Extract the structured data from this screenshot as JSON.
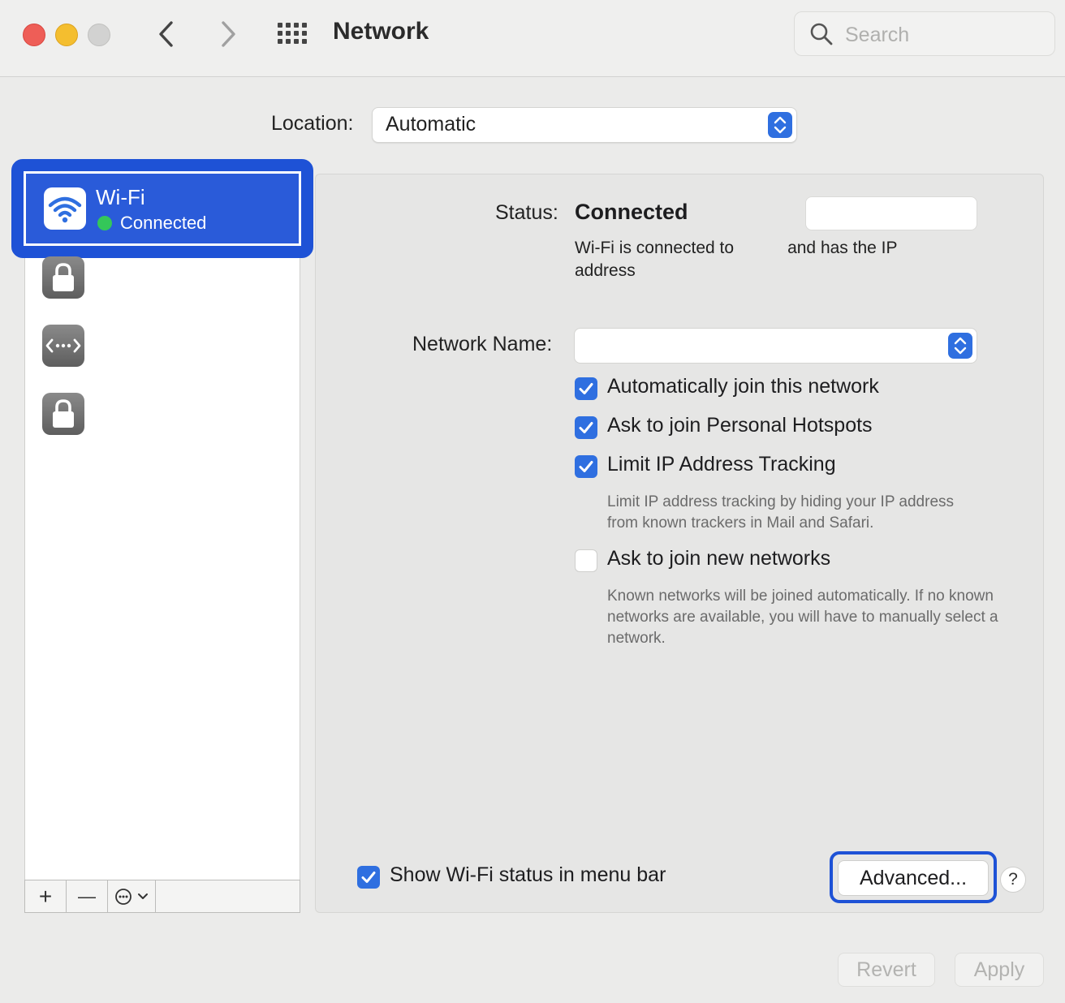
{
  "window": {
    "title": "Network",
    "search_placeholder": "Search"
  },
  "location": {
    "label": "Location:",
    "value": "Automatic"
  },
  "sidebar": {
    "selected_service": {
      "name": "Wi-Fi",
      "status": "Connected",
      "icon": "wifi-icon",
      "status_color": "#34c759"
    },
    "other_services": [
      {
        "icon": "lock-icon"
      },
      {
        "icon": "vpn-arrows-icon"
      },
      {
        "icon": "lock-icon"
      }
    ],
    "toolbar": {
      "add": "+",
      "remove": "—",
      "action_icon": "ellipsis-circle-icon"
    }
  },
  "detail": {
    "status_label": "Status:",
    "status_value": "Connected",
    "status_desc_part1": "Wi-Fi is connected to",
    "status_desc_part2": "and has the IP address",
    "network_name_label": "Network Name:",
    "checkboxes": [
      {
        "label": "Automatically join this network",
        "checked": true
      },
      {
        "label": "Ask to join Personal Hotspots",
        "checked": true
      },
      {
        "label": "Limit IP Address Tracking",
        "checked": true,
        "help": "Limit IP address tracking by hiding your IP address from known trackers in Mail and Safari."
      },
      {
        "label": "Ask to join new networks",
        "checked": false,
        "help": "Known networks will be joined automatically. If no known networks are available, you will have to manually select a network."
      }
    ],
    "show_status": {
      "label": "Show Wi-Fi status in menu bar",
      "checked": true
    },
    "advanced_button": "Advanced...",
    "help_button": "?"
  },
  "footer": {
    "revert": "Revert",
    "apply": "Apply"
  },
  "colors": {
    "accent": "#2f6fe0",
    "highlight_ring": "#1e52d6"
  }
}
